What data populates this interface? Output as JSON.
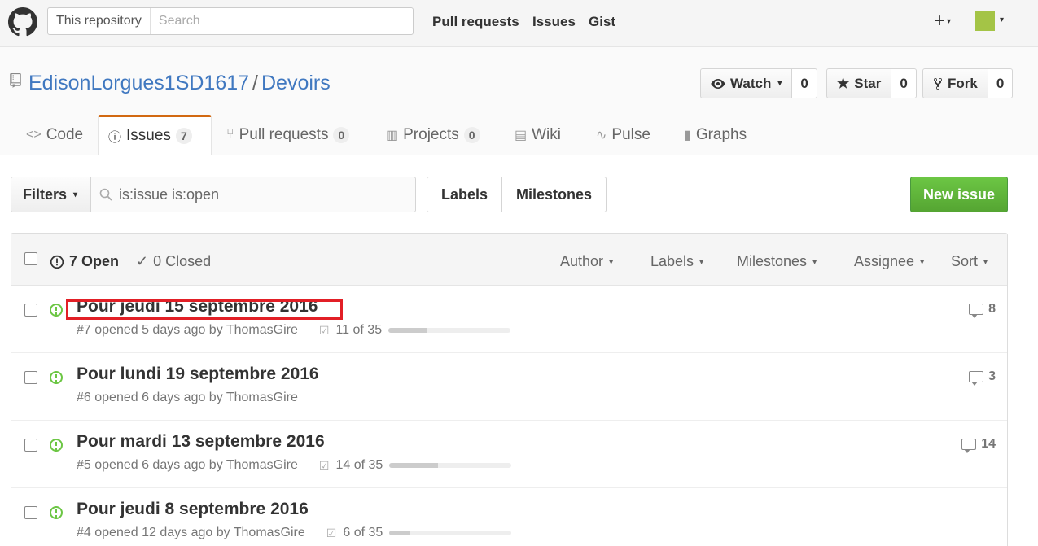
{
  "topbar": {
    "search_scope": "This repository",
    "search_placeholder": "Search",
    "nav": {
      "pull_requests": "Pull requests",
      "issues": "Issues",
      "gist": "Gist"
    },
    "plus": "+"
  },
  "repo": {
    "owner": "EdisonLorgues1SD1617",
    "separator": "/",
    "name": "Devoirs",
    "watch": {
      "label": "Watch",
      "count": "0"
    },
    "star": {
      "label": "Star",
      "count": "0"
    },
    "fork": {
      "label": "Fork",
      "count": "0"
    }
  },
  "tabs": {
    "code": {
      "label": "Code"
    },
    "issues": {
      "label": "Issues",
      "count": "7"
    },
    "pull_requests": {
      "label": "Pull requests",
      "count": "0"
    },
    "projects": {
      "label": "Projects",
      "count": "0"
    },
    "wiki": {
      "label": "Wiki"
    },
    "pulse": {
      "label": "Pulse"
    },
    "graphs": {
      "label": "Graphs"
    }
  },
  "filters": {
    "button_label": "Filters",
    "query": "is:issue is:open",
    "labels_label": "Labels",
    "milestones_label": "Milestones",
    "new_issue_label": "New issue"
  },
  "issues_header": {
    "open_label": "7 Open",
    "closed_label": "0 Closed",
    "author": "Author",
    "labels": "Labels",
    "milestones": "Milestones",
    "assignee": "Assignee",
    "sort": "Sort"
  },
  "issues": [
    {
      "title": "Pour jeudi 15 septembre 2016",
      "meta": "#7 opened 5 days ago by ThomasGire",
      "progress": "11 of 35",
      "progress_fraction": 0.314,
      "comments": "8"
    },
    {
      "title": "Pour lundi 19 septembre 2016",
      "meta": "#6 opened 6 days ago by ThomasGire",
      "progress": "",
      "progress_fraction": 0,
      "comments": "3"
    },
    {
      "title": "Pour mardi 13 septembre 2016",
      "meta": "#5 opened 6 days ago by ThomasGire",
      "progress": "14 of 35",
      "progress_fraction": 0.4,
      "comments": "14"
    },
    {
      "title": "Pour jeudi 8 septembre 2016",
      "meta": "#4 opened 12 days ago by ThomasGire",
      "progress": "6 of 35",
      "progress_fraction": 0.171,
      "comments": ""
    }
  ],
  "colors": {
    "link_blue": "#4078c0",
    "open_green": "#6cc644",
    "new_issue_green": "#55a532",
    "tab_accent": "#d26911",
    "highlight_red": "#e21f26"
  }
}
